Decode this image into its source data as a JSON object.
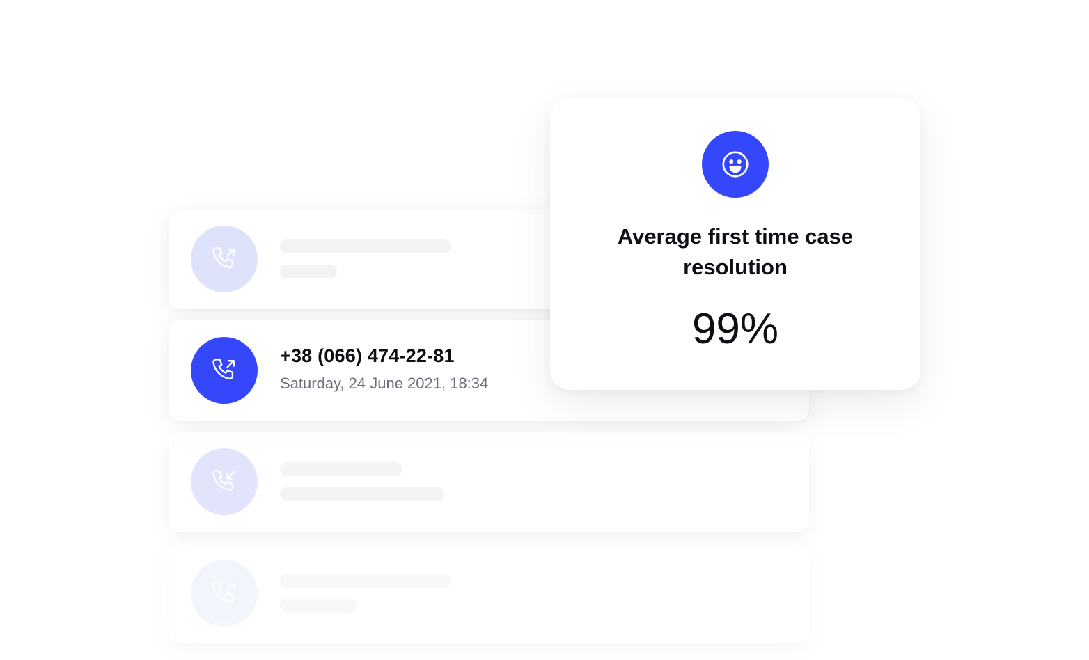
{
  "call_list": {
    "featured_call": {
      "phone": "+38 (066) 474-22-81",
      "datetime": "Saturday, 24 June 2021, 18:34",
      "direction_icon": "phone-outgoing-icon"
    },
    "placeholder_icons": [
      "phone-outgoing-icon",
      "phone-incoming-icon",
      "phone-outgoing-icon"
    ]
  },
  "stat_card": {
    "icon": "smiley-icon",
    "title": "Average first time case resolution",
    "value": "99%"
  },
  "colors": {
    "accent": "#3447fb",
    "accent_light": "#dfe2fb",
    "skeleton": "#f3f3f4",
    "text_primary": "#0e0e14",
    "text_secondary": "#6d6d78"
  }
}
